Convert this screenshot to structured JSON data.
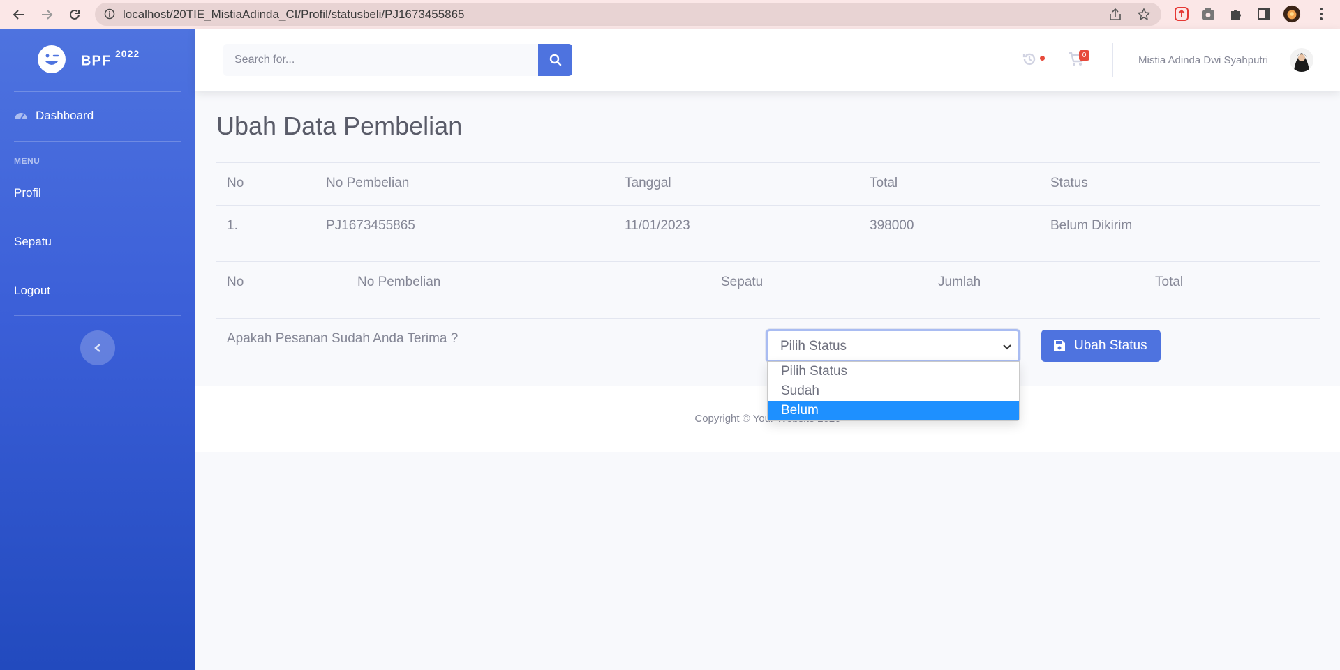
{
  "browser": {
    "url": "localhost/20TIE_MistiaAdinda_CI/Profil/statusbeli/PJ1673455865"
  },
  "sidebar": {
    "brand_name": "BPF",
    "brand_year": "2022",
    "dashboard_label": "Dashboard",
    "menu_heading": "MENU",
    "items": [
      {
        "label": "Profil"
      },
      {
        "label": "Sepatu"
      },
      {
        "label": "Logout"
      }
    ]
  },
  "topbar": {
    "search_placeholder": "Search for...",
    "cart_count": "0",
    "user_name": "Mistia Adinda Dwi Syahputri"
  },
  "main": {
    "title": "Ubah Data Pembelian",
    "order_table": {
      "headers": [
        "No",
        "No Pembelian",
        "Tanggal",
        "Total",
        "Status"
      ],
      "rows": [
        [
          "1.",
          "PJ1673455865",
          "11/01/2023",
          "398000",
          "Belum Dikirim"
        ]
      ]
    },
    "detail_table": {
      "headers": [
        "No",
        "No Pembelian",
        "Sepatu",
        "Jumlah",
        "Total"
      ]
    },
    "form": {
      "question": "Apakah Pesanan Sudah Anda Terima ?",
      "select_value": "Pilih Status",
      "options": [
        "Pilih Status",
        "Sudah",
        "Belum"
      ],
      "highlighted_option": "Belum",
      "submit_label": "Ubah Status"
    }
  },
  "footer": {
    "copyright": "Copyright © Your Website 2020"
  },
  "colors": {
    "primary": "#4e73df",
    "sidebar_bottom": "#224abe",
    "text_muted": "#858796",
    "danger": "#e74a3b",
    "option_highlight": "#1e90ff"
  }
}
